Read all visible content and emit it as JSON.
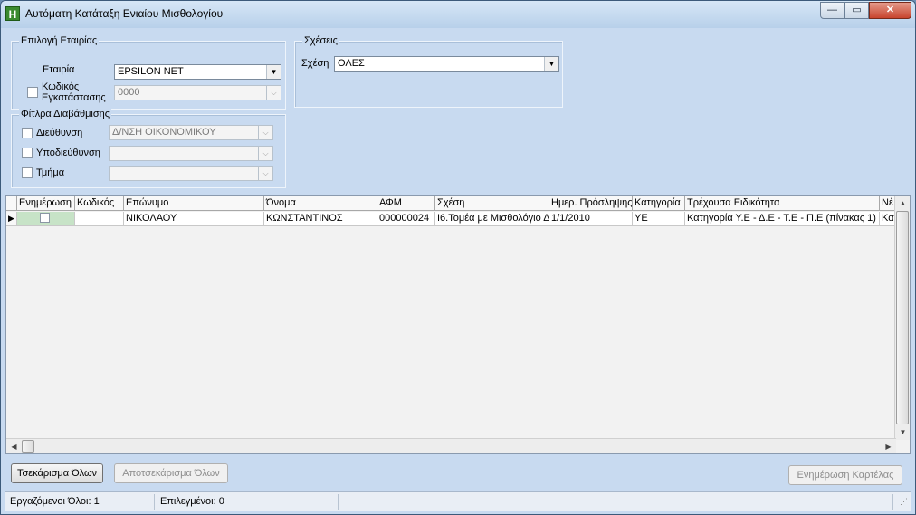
{
  "window": {
    "title": "Αυτόματη Κατάταξη Ενιαίου Μισθολογίου",
    "app_icon_letter": "H",
    "btn_min": "—",
    "btn_max": "▭",
    "btn_close": "✕"
  },
  "company_group": {
    "title": "Επιλογή Εταιρίας",
    "company_label": "Εταιρία",
    "company_value": "EPSILON NET",
    "install_label_1": "Κωδικός",
    "install_label_2": "Εγκατάστασης",
    "install_value": "0000",
    "install_checked": false
  },
  "relations_group": {
    "title": "Σχέσεις",
    "relation_label": "Σχέση",
    "relation_value": "ΟΛΕΣ"
  },
  "filter_group": {
    "title": "Φίτλρα Διαβάθμισης",
    "direction_label": "Διεύθυνση",
    "direction_value": "Δ/ΝΣΗ ΟΙΚΟΝΟΜΙΚΟΥ",
    "subdirection_label": "Υποδιεύθυνση",
    "subdirection_value": "",
    "department_label": "Τμήμα",
    "department_value": ""
  },
  "grid": {
    "columns": [
      "Ενημέρωση",
      "Κωδικός",
      "Επώνυμο",
      "Όνομα",
      "ΑΦΜ",
      "Σχέση",
      "Ημερ. Πρόσληψης",
      "Κατηγορία",
      "Τρέχουσα Ειδικότητα",
      "Νέ"
    ],
    "rows": [
      [
        "",
        "",
        "ΝΙΚΟΛΑΟΥ",
        "ΚΩΝΣΤΑΝΤΙΝΟΣ",
        "000000024",
        "Ι6.Τομέα με Μισθολόγιο Δ",
        "1/1/2010",
        "ΥΕ",
        "Κατηγορία Υ.Ε - Δ.Ε - Τ.Ε - Π.Ε (πίνακας 1)",
        "Κατ"
      ]
    ]
  },
  "buttons": {
    "check_all": "Τσεκάρισμα Όλων",
    "uncheck_all": "Αποτσεκάρισμα Όλων",
    "update_cards": "Ενημέρωση Καρτέλας"
  },
  "status": {
    "processed": "Εργαζόμενοι Όλοι: 1",
    "selected": "Επιλεγμένοι: 0"
  }
}
